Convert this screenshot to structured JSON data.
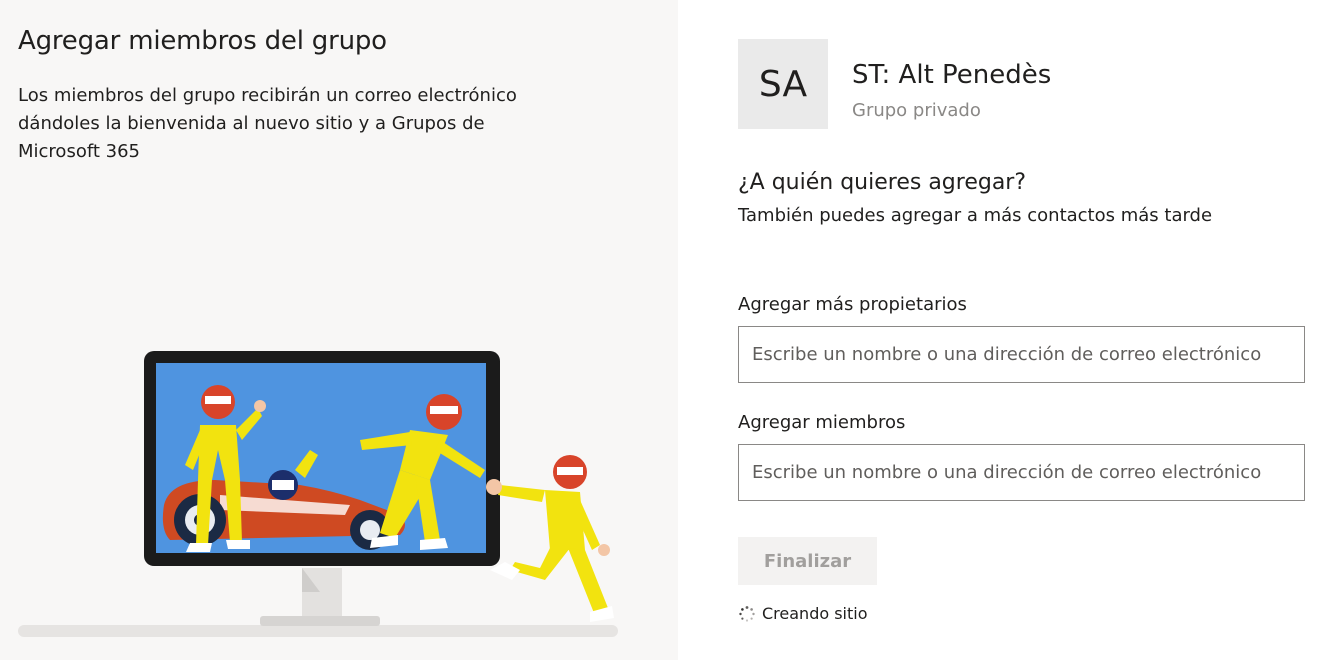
{
  "left": {
    "title": "Agregar miembros del grupo",
    "description": "Los miembros del grupo recibirán un correo electrónico dándoles la bienvenida al nuevo sitio y a Grupos de Microsoft 365",
    "illustration": "team-racing-monitor-illustration"
  },
  "group": {
    "avatar_initials": "SA",
    "name": "ST: Alt Penedès",
    "type": "Grupo privado"
  },
  "prompt": {
    "title": "¿A quién quieres agregar?",
    "subtitle": "También puedes agregar a más contactos más tarde"
  },
  "owners": {
    "label": "Agregar más propietarios",
    "placeholder": "Escribe un nombre o una dirección de correo electrónico",
    "value": ""
  },
  "members": {
    "label": "Agregar miembros",
    "placeholder": "Escribe un nombre o una dirección de correo electrónico",
    "value": ""
  },
  "actions": {
    "finish_label": "Finalizar"
  },
  "status": {
    "text": "Creando sitio",
    "icon": "loading-spinner-icon"
  },
  "colors": {
    "left_background": "#f8f7f6",
    "avatar_background": "#eaeaea",
    "disabled_button_bg": "#f3f2f1",
    "disabled_button_text": "#a19f9d",
    "suit_yellow": "#f2e30f",
    "helmet_red": "#d8442a",
    "screen_blue": "#4f94e0"
  }
}
